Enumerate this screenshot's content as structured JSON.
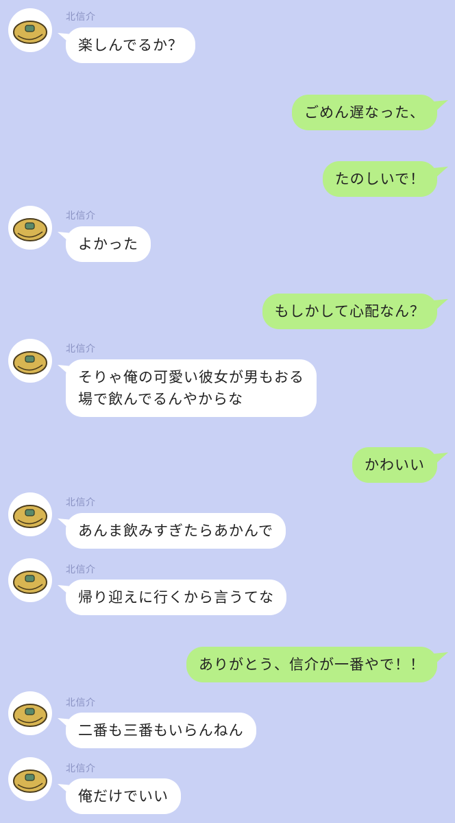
{
  "theme": {
    "background": "#c9d1f5",
    "incoming_bubble": "#ffffff",
    "outgoing_bubble": "#b7ef88",
    "sender_name_color": "#8a92c3"
  },
  "avatar_icon": "melon-pan-icon",
  "messages": [
    {
      "side": "in",
      "sender": "北信介",
      "text": "楽しんでるか？"
    },
    {
      "side": "out",
      "text": "ごめん遅なった、"
    },
    {
      "side": "out",
      "text": "たのしいで！"
    },
    {
      "side": "in",
      "sender": "北信介",
      "text": "よかった"
    },
    {
      "side": "out",
      "text": "もしかして心配なん？"
    },
    {
      "side": "in",
      "sender": "北信介",
      "lines": [
        "そりゃ俺の可愛い彼女が男もおる",
        "場で飲んでるんやからな"
      ]
    },
    {
      "side": "out",
      "text": "かわいい"
    },
    {
      "side": "in",
      "sender": "北信介",
      "text": "あんま飲みすぎたらあかんで"
    },
    {
      "side": "in",
      "sender": "北信介",
      "text": "帰り迎えに行くから言うてな"
    },
    {
      "side": "out",
      "text": "ありがとう、信介が一番やで！！"
    },
    {
      "side": "in",
      "sender": "北信介",
      "text": "二番も三番もいらんねん"
    },
    {
      "side": "in",
      "sender": "北信介",
      "text": "俺だけでいい"
    }
  ]
}
